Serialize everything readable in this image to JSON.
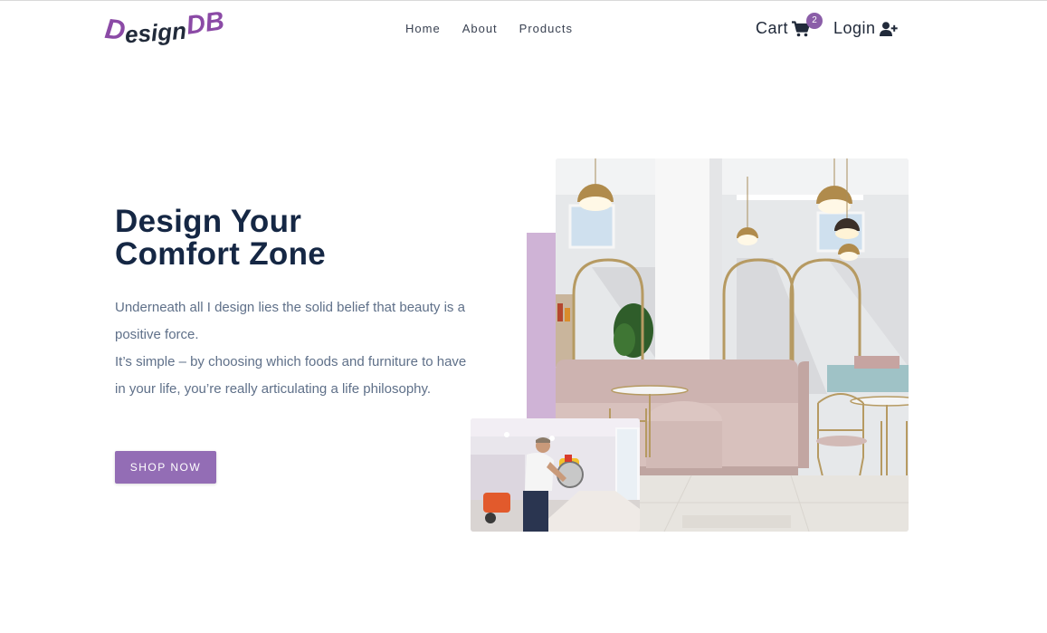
{
  "brand": {
    "logo_letter_d": "D",
    "logo_word": "esign",
    "logo_db": "DB",
    "accent_color": "#8b4aa6"
  },
  "nav": {
    "items": [
      {
        "label": "Home"
      },
      {
        "label": "About"
      },
      {
        "label": "Products"
      }
    ]
  },
  "header": {
    "cart_label": "Cart",
    "cart_count": "2",
    "login_label": "Login",
    "cart_icon": "shopping-cart-icon",
    "login_icon": "user-plus-icon"
  },
  "hero": {
    "title_line1": "Design Your",
    "title_line2": "Comfort Zone",
    "paragraph1": "Underneath all I design lies the solid belief that beauty is a positive force.",
    "paragraph2": "It’s simple – by choosing which foods and furniture to have in your life, you’re really articulating a life philosophy.",
    "cta_label": "SHOP NOW",
    "cta_color": "#936db5",
    "accent_block_color": "#cfb3d6"
  }
}
